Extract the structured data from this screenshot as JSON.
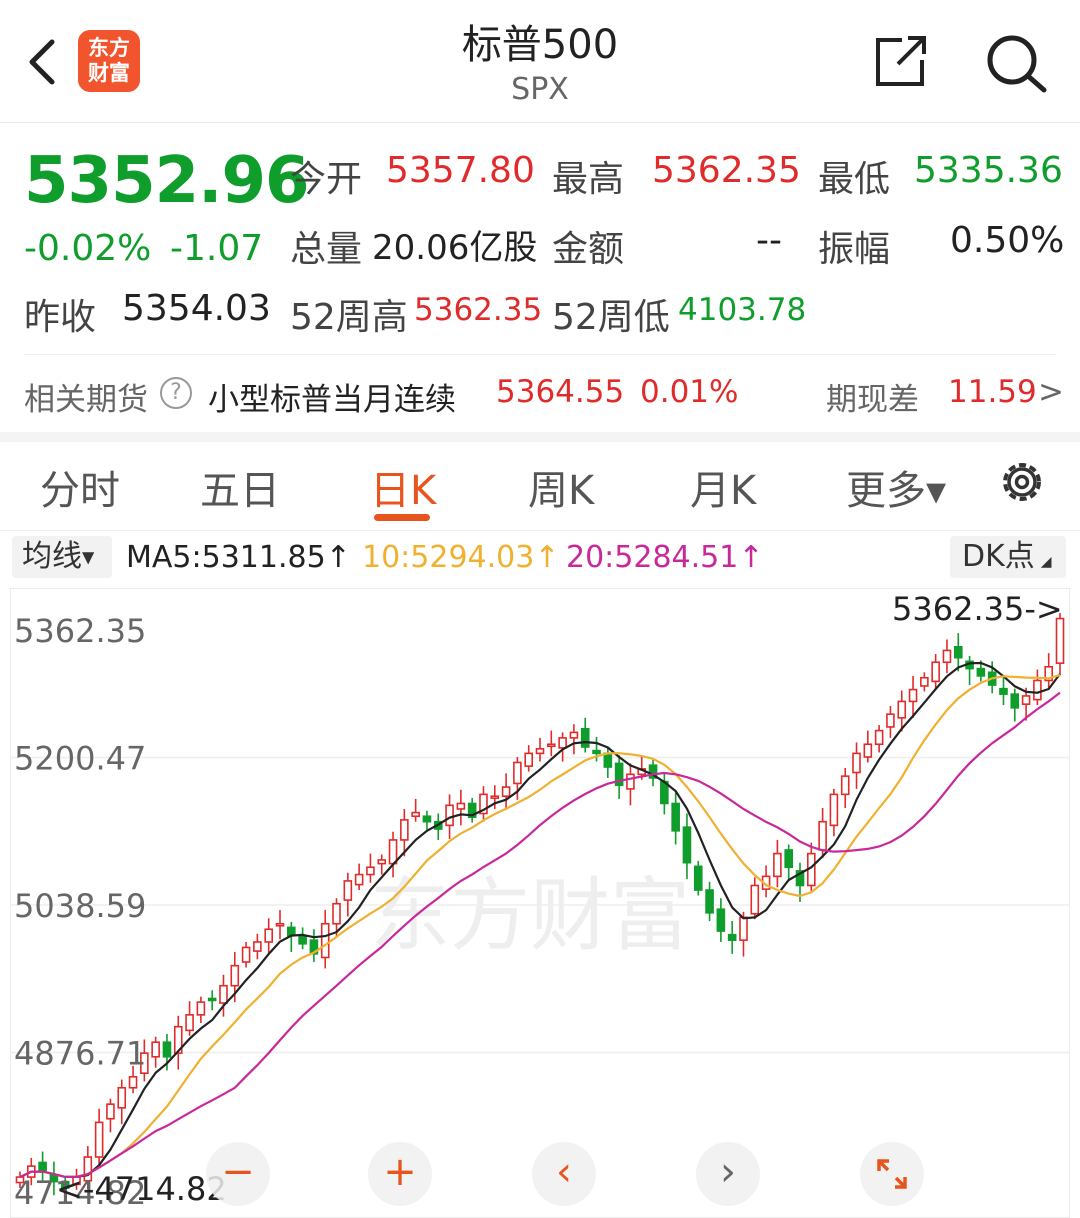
{
  "header": {
    "title": "标普500",
    "subtitle": "SPX",
    "logo_line1": "东方",
    "logo_line2": "财富"
  },
  "quote": {
    "price": "5352.96",
    "change_pct": "-0.02%",
    "change_abs": "-1.07",
    "open_label": "今开",
    "open": "5357.80",
    "high_label": "最高",
    "high": "5362.35",
    "low_label": "最低",
    "low": "5335.36",
    "volume_label": "总量",
    "volume": "20.06亿股",
    "amount_label": "金额",
    "amount": "--",
    "amplitude_label": "振幅",
    "amplitude": "0.50%",
    "prev_close_label": "昨收",
    "prev_close": "5354.03",
    "w52_high_label": "52周高",
    "w52_high": "5362.35",
    "w52_low_label": "52周低",
    "w52_low": "4103.78"
  },
  "futures": {
    "label": "相关期货",
    "help_icon": "?",
    "name": "小型标普当月连续",
    "price": "5364.55",
    "pct": "0.01%",
    "basis_label": "期现差",
    "basis": "11.59",
    "arrow": ">"
  },
  "tabs": [
    {
      "label": "分时"
    },
    {
      "label": "五日"
    },
    {
      "label": "日K"
    },
    {
      "label": "周K"
    },
    {
      "label": "月K"
    },
    {
      "label": "更多▾"
    }
  ],
  "ma_row": {
    "toggle_label": "均线",
    "ma5": "MA5:5311.85↑",
    "ma10": "10:5294.03↑",
    "ma20": "20:5284.51↑",
    "dk_label": "DK点"
  },
  "colors": {
    "up": "#e02b2b",
    "down": "#0f9d2c",
    "ma5": "#222222",
    "ma10": "#f0b030",
    "ma20": "#c8299a",
    "accent": "#e8541e"
  },
  "chart_data": {
    "type": "candlestick",
    "y_ticks": [
      "5362.35",
      "5200.47",
      "5038.59",
      "4876.71",
      "4714.82"
    ],
    "ylim": [
      4714.82,
      5362.35
    ],
    "max_marker": "5362.35->",
    "min_marker": "<-4714.82",
    "watermark": "东方财富",
    "closes": [
      4740,
      4752,
      4746,
      4735,
      4728,
      4740,
      4762,
      4800,
      4820,
      4838,
      4850,
      4876,
      4888,
      4872,
      4905,
      4918,
      4932,
      4935,
      4950,
      4972,
      4992,
      4998,
      5012,
      5018,
      5005,
      4996,
      4985,
      5018,
      5040,
      5065,
      5072,
      5080,
      5088,
      5110,
      5132,
      5140,
      5130,
      5122,
      5148,
      5150,
      5135,
      5160,
      5158,
      5168,
      5195,
      5205,
      5210,
      5215,
      5222,
      5228,
      5212,
      5205,
      5190,
      5170,
      5182,
      5188,
      5178,
      5150,
      5120,
      5085,
      5055,
      5030,
      5010,
      5000,
      5025,
      5060,
      5070,
      5095,
      5080,
      5060,
      5095,
      5130,
      5160,
      5180,
      5205,
      5215,
      5230,
      5248,
      5262,
      5275,
      5288,
      5305,
      5318,
      5310,
      5298,
      5290,
      5280,
      5270,
      5255,
      5268,
      5285,
      5300,
      5352.96
    ],
    "ma5": 5311.85,
    "ma10": 5294.03,
    "ma20": 5284.51
  },
  "chart_controls": {
    "zoom_out": "−",
    "zoom_in": "+",
    "prev": "‹",
    "next": "›"
  }
}
